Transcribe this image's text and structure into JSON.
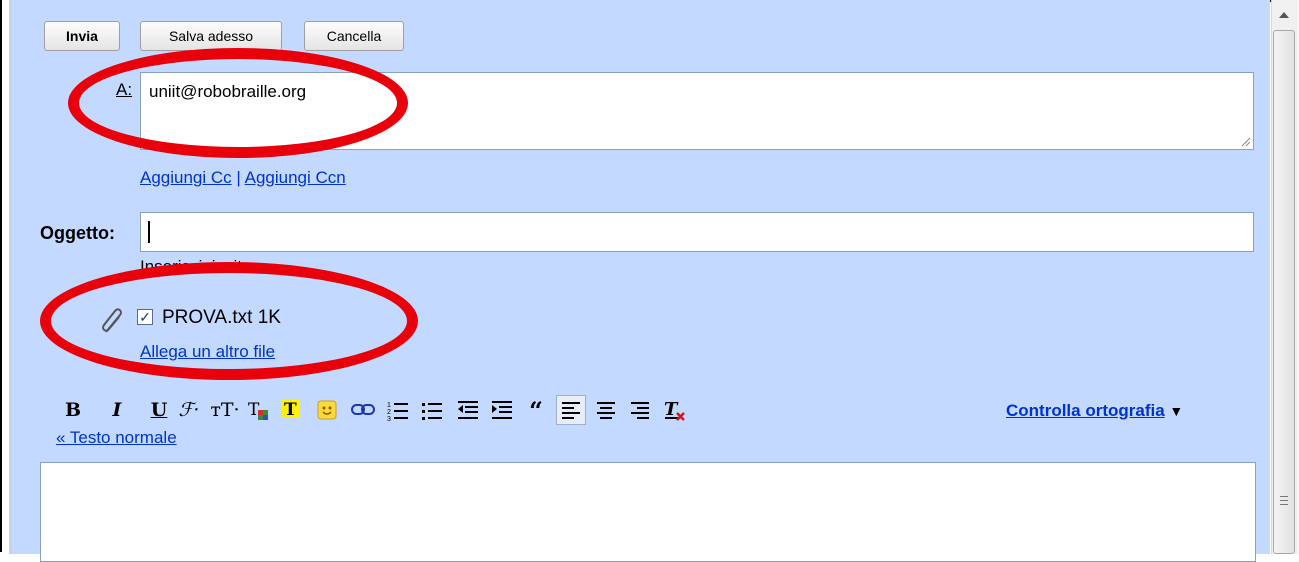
{
  "toolbar": {
    "send_label": "Invia",
    "save_label": "Salva adesso",
    "cancel_label": "Cancella"
  },
  "to": {
    "label": "A:",
    "value": "uniit@robobraille.org",
    "add_cc": "Aggiungi Cc",
    "separator": "|",
    "add_bcc": "Aggiungi Ccn"
  },
  "subject": {
    "label": "Oggetto:",
    "value": "",
    "below_text": "Inserisci: invito"
  },
  "attachment": {
    "filename": "PROVA.txt",
    "size": "1K",
    "checked": true,
    "attach_another": "Allega un altro file"
  },
  "format_toolbar": {
    "icons": [
      "bold-icon",
      "italic-icon",
      "underline-icon",
      "font-icon",
      "font-size-icon",
      "text-color-icon",
      "highlight-icon",
      "emoji-icon",
      "link-icon",
      "numbered-list-icon",
      "bullet-list-icon",
      "indent-less-icon",
      "indent-more-icon",
      "quote-icon",
      "align-left-icon",
      "align-center-icon",
      "align-right-icon",
      "remove-formatting-icon"
    ],
    "spell_check": "Controlla ortografia",
    "spell_arrow": "▼",
    "plain_text": "« Testo normale"
  },
  "colors": {
    "panel": "#c3d9ff",
    "link": "#0033cc",
    "annotation": "#e8000a"
  }
}
